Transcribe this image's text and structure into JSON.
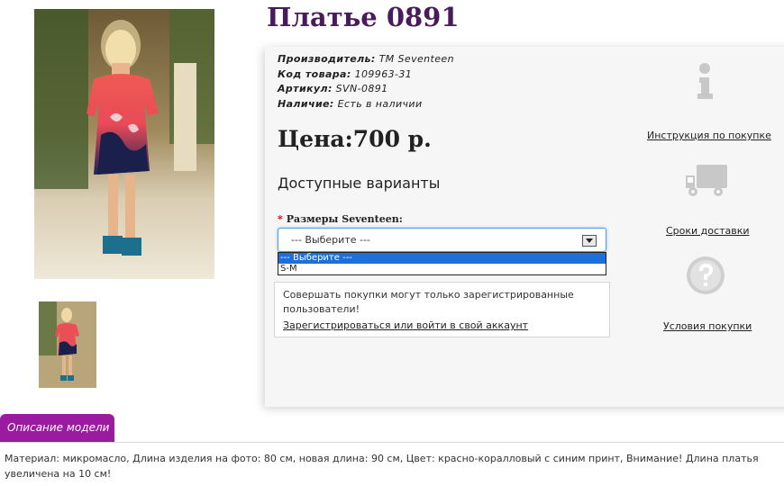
{
  "product": {
    "title": "Платье 0891",
    "images": {
      "main_alt": "product-photo",
      "thumb_alt": "product-thumbnail"
    }
  },
  "meta": {
    "manufacturer_label": "Производитель:",
    "manufacturer_value": "TM Seventeen",
    "code_label": "Код товара:",
    "code_value": "109963-31",
    "article_label": "Артикул:",
    "article_value": "SVN-0891",
    "availability_label": "Наличие:",
    "availability_value": "Есть в наличии"
  },
  "price": "Цена:700 р.",
  "variants": {
    "heading": "Доступные варианты",
    "required_mark": "*",
    "size_label": "Размеры Seventeen:",
    "select_value": "--- Выберите ---",
    "options": [
      "--- Выберите ---",
      "S-M"
    ]
  },
  "notice": {
    "text": "Совершать покупки могут только зарегистрированные пользователи!",
    "link": "Зарегистрироваться или войти в свой аккаунт"
  },
  "side": {
    "instruction_link": "Инструкция по покупке",
    "delivery_link": "Сроки доставки",
    "terms_link": "Условия покупки",
    "icons": [
      "info-icon",
      "delivery-truck-icon",
      "question-icon"
    ]
  },
  "tab": {
    "label": "Описание модели"
  },
  "description": "Материал: микромасло, Длина изделия на фото: 80 см, новая длина: 90 см, Цвет: красно-коралловый с синим принт, Внимание! Длина платья увеличена на 10 см!",
  "colors": {
    "title": "#4a1b5c",
    "tab": "#9a1aa0",
    "select_highlight": "#1e6fd9",
    "required": "#d40000"
  }
}
